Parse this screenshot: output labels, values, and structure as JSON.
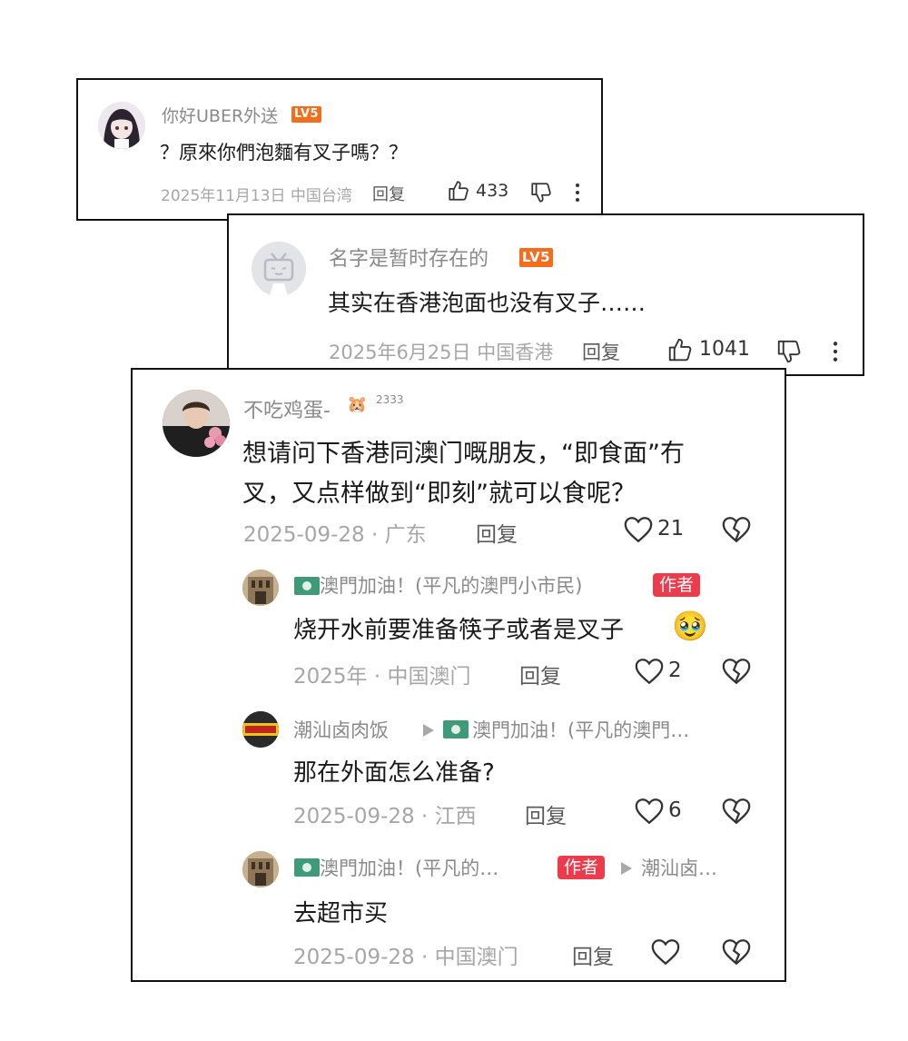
{
  "card1": {
    "username": "你好UBER外送",
    "level": "LV5",
    "text": "？原來你們泡麵有叉子嗎？？",
    "date_location": "2025年11月13日 中国台湾",
    "reply": "回复",
    "likes": "433"
  },
  "card2": {
    "username": "名字是暂时存在的",
    "level": "LV5",
    "text": "其实在香港泡面也没有叉子……",
    "date_location": "2025年6月25日 中国香港",
    "reply": "回复",
    "likes": "1041"
  },
  "card3": {
    "main": {
      "username": "不吃鸡蛋-",
      "badge": "2333",
      "text_line1": "想请问下香港同澳门嘅朋友，“即食面”冇",
      "text_line2": "叉，又点样做到“即刻”就可以食呢？",
      "date_location": "2025-09-28 · 广东",
      "reply": "回复",
      "likes": "21"
    },
    "replies": [
      {
        "username": "澳門加油！(平凡的澳門小市民)",
        "author_tag": "作者",
        "text": "烧开水前要准备筷子或者是叉子",
        "emoji": "🥹",
        "date_location": "2025年 · 中国澳门",
        "reply": "回复",
        "likes": "2"
      },
      {
        "username": "潮汕卤肉饭",
        "reply_to": "澳門加油！(平凡的澳門…",
        "text": "那在外面怎么准备?",
        "date_location": "2025-09-28 · 江西",
        "reply": "回复",
        "likes": "6"
      },
      {
        "username": "澳門加油！(平凡的…",
        "author_tag": "作者",
        "reply_to": "潮汕卤…",
        "text": "去超市买",
        "date_location": "2025-09-28 · 中国澳门",
        "reply": "回复",
        "likes": ""
      }
    ]
  },
  "icons": {
    "thumb_up": "thumb-up-icon",
    "thumb_down": "thumb-down-icon",
    "more": "more-vertical-icon",
    "heart": "heart-icon",
    "broken_heart": "dislike-heart-icon",
    "flag": "macau-flag-icon",
    "reply_arrow": "reply-arrow-icon"
  },
  "colors": {
    "level_badge": "#f56c1c",
    "author_tag": "#ee3b4c",
    "border": "#111111",
    "meta_text": "#a6a6a6"
  }
}
